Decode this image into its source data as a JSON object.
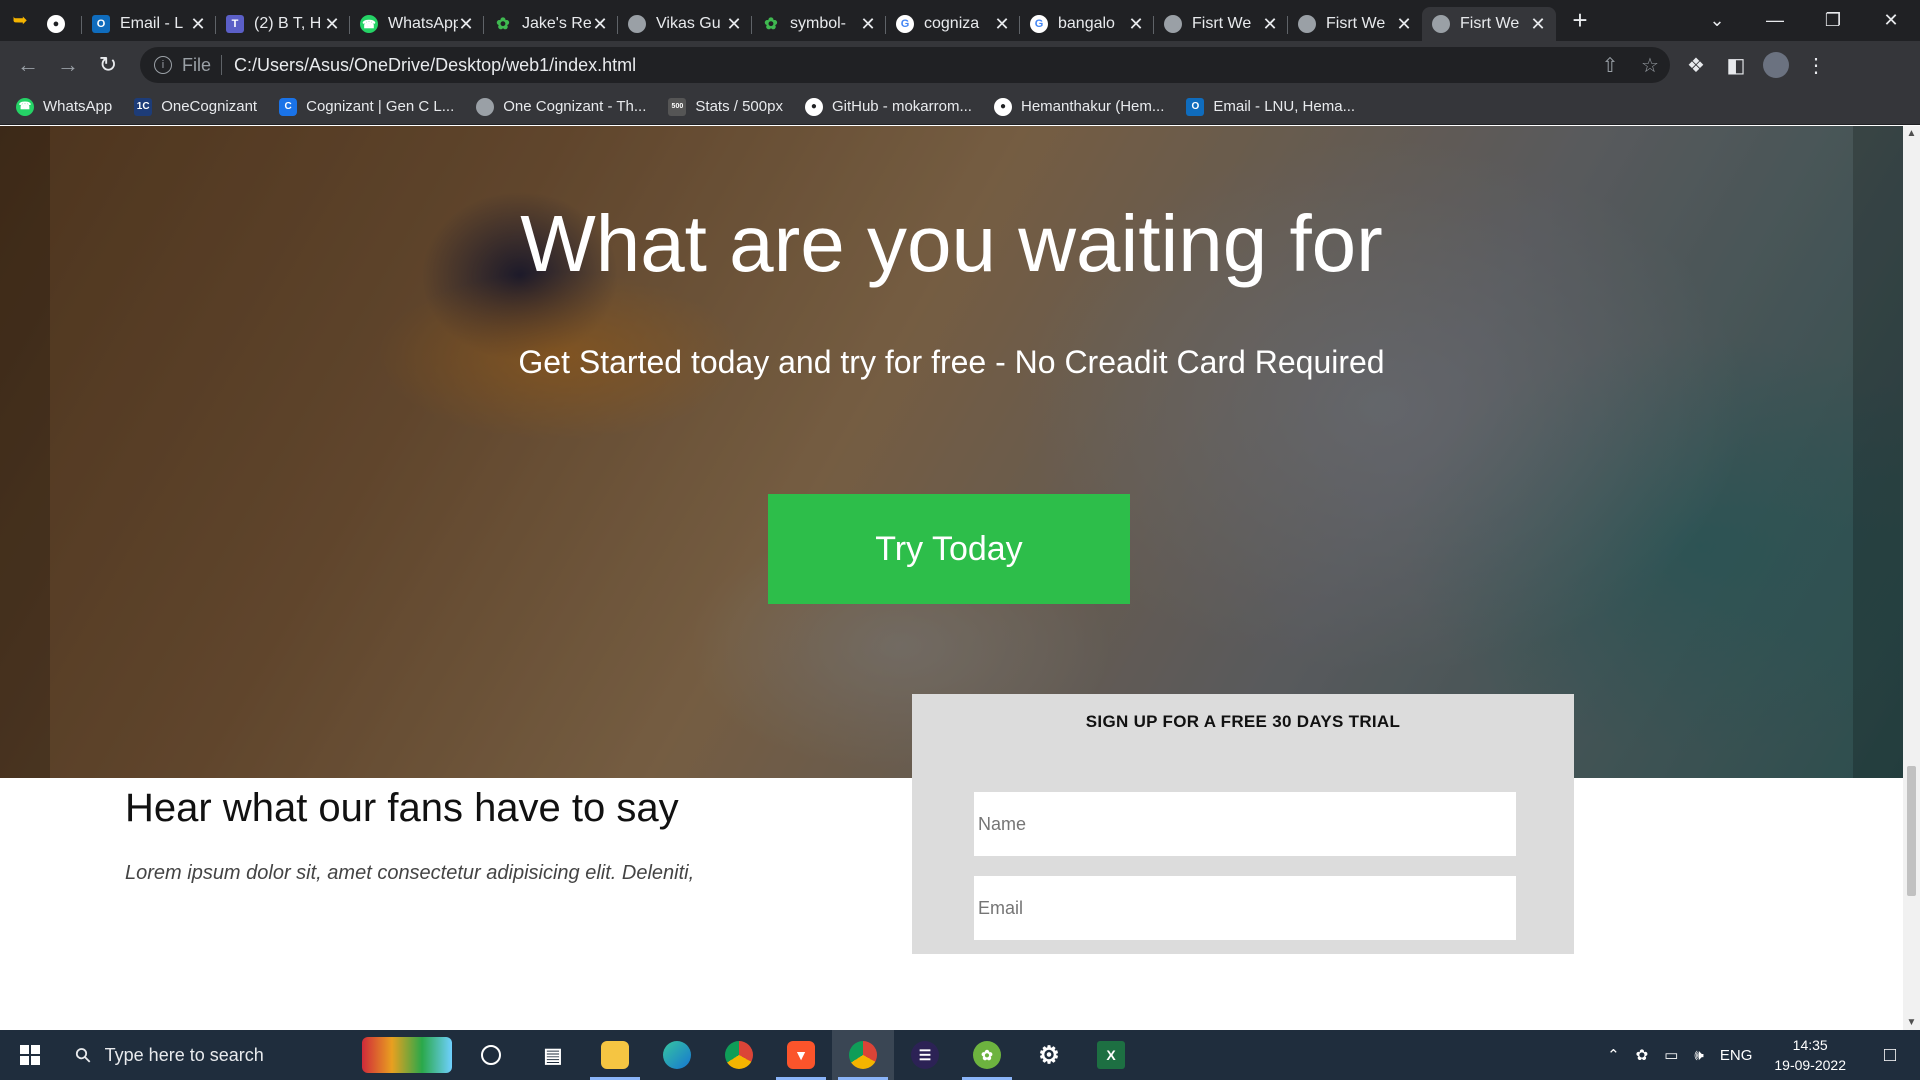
{
  "browser": {
    "tabs": [
      {
        "title": "",
        "icon": "github-icon",
        "color": "#ffffff"
      },
      {
        "title": "Email - L",
        "icon": "outlook-icon",
        "color": "#0f6cbd"
      },
      {
        "title": "(2) B T, H",
        "icon": "teams-icon",
        "color": "#5b5fc7"
      },
      {
        "title": "WhatsApp",
        "icon": "whatsapp-icon",
        "color": "#25d366"
      },
      {
        "title": "Jake's Re",
        "icon": "leaf-icon",
        "color": "#3fb950"
      },
      {
        "title": "Vikas Gu",
        "icon": "globe-icon",
        "color": "#9aa0a6"
      },
      {
        "title": "symbol-",
        "icon": "leaf-icon",
        "color": "#3fb950"
      },
      {
        "title": "cogniza",
        "icon": "google-icon",
        "color": "#ffffff"
      },
      {
        "title": "bangalo",
        "icon": "google-icon",
        "color": "#ffffff"
      },
      {
        "title": "Fisrt We",
        "icon": "globe-icon",
        "color": "#9aa0a6"
      },
      {
        "title": "Fisrt We",
        "icon": "globe-icon",
        "color": "#9aa0a6"
      },
      {
        "title": "Fisrt We",
        "icon": "globe-icon",
        "color": "#9aa0a6",
        "active": true
      }
    ],
    "address": {
      "scheme": "File",
      "url": "C:/Users/Asus/OneDrive/Desktop/web1/index.html"
    },
    "bookmarks": [
      {
        "label": "WhatsApp",
        "icon": "whatsapp-icon",
        "color": "#25d366"
      },
      {
        "label": "OneCognizant",
        "icon": "onecognizant-icon",
        "color": "#1d3c78"
      },
      {
        "label": "Cognizant | Gen C L...",
        "icon": "cognizant-icon",
        "color": "#1a73e8"
      },
      {
        "label": "One Cognizant - Th...",
        "icon": "globe-icon",
        "color": "#9aa0a6"
      },
      {
        "label": "Stats / 500px",
        "icon": "500px-icon",
        "color": "#555555"
      },
      {
        "label": "GitHub - mokarrom...",
        "icon": "github-icon",
        "color": "#ffffff"
      },
      {
        "label": "Hemanthakur (Hem...",
        "icon": "github-icon",
        "color": "#ffffff"
      },
      {
        "label": "Email - LNU, Hema...",
        "icon": "outlook-icon",
        "color": "#0f6cbd"
      }
    ]
  },
  "page": {
    "hero": {
      "title": "What are you waiting for",
      "subtitle": "Get Started today and try for free - No Creadit Card Required",
      "cta": "Try Today",
      "cta_color": "#2dbe4a"
    },
    "fans": {
      "title": "Hear what our fans have to say",
      "text": "Lorem ipsum dolor sit, amet consectetur adipisicing elit. Deleniti,"
    },
    "signup": {
      "title": "SIGN UP FOR A FREE 30 DAYS TRIAL",
      "name_placeholder": "Name",
      "email_placeholder": "Email"
    }
  },
  "taskbar": {
    "search_placeholder": "Type here to search",
    "language": "ENG",
    "time": "14:35",
    "date": "19-09-2022"
  }
}
